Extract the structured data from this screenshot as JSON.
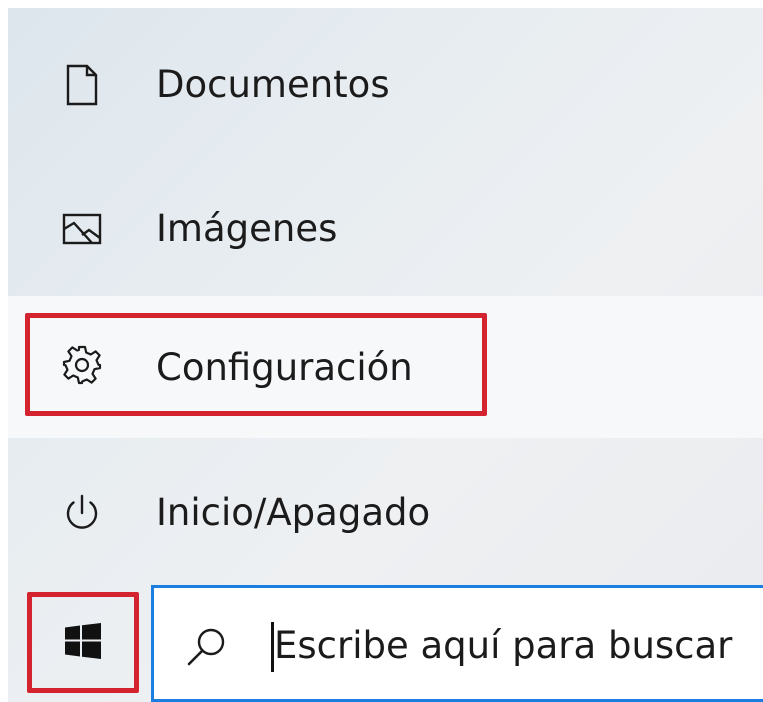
{
  "start_menu": {
    "items": [
      {
        "label": "Documentos",
        "icon": "document-icon"
      },
      {
        "label": "Imágenes",
        "icon": "image-icon"
      },
      {
        "label": "Configuración",
        "icon": "gear-icon"
      },
      {
        "label": "Inicio/Apagado",
        "icon": "power-icon"
      }
    ]
  },
  "taskbar": {
    "start_icon": "windows-logo-icon",
    "search": {
      "placeholder": "Escribe aquí para buscar",
      "icon": "search-icon"
    }
  },
  "colors": {
    "highlight": "#d2232f",
    "search_border": "#1a7fe0"
  }
}
